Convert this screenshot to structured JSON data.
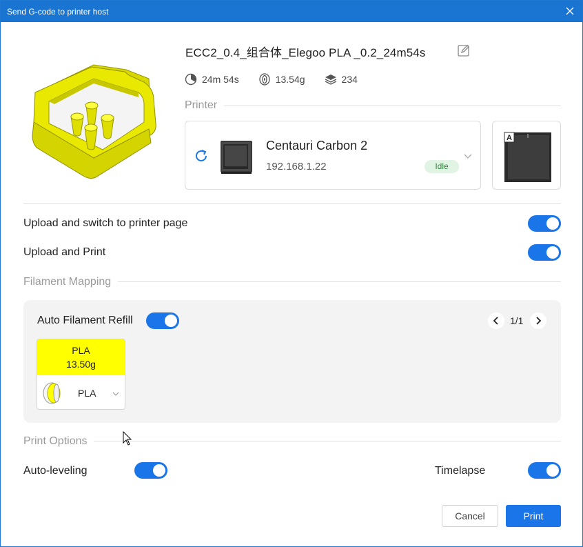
{
  "window": {
    "title": "Send G-code to printer host"
  },
  "file": {
    "name": "ECC2_0.4_组合体_Elegoo PLA _0.2_24m54s",
    "time": "24m 54s",
    "weight": "13.54g",
    "layers": "234"
  },
  "printer_section": {
    "label": "Printer",
    "name": "Centauri Carbon 2",
    "ip": "192.168.1.22",
    "status": "Idle",
    "plate_badge": "A"
  },
  "options": {
    "upload_switch_label": "Upload and switch to printer page",
    "upload_switch_on": true,
    "upload_print_label": "Upload and Print",
    "upload_print_on": true
  },
  "filament_mapping": {
    "label": "Filament Mapping",
    "auto_refill_label": "Auto Filament Refill",
    "auto_refill_on": true,
    "page": "1/1",
    "slots": [
      {
        "type": "PLA",
        "weight": "13.50g",
        "color": "#ffff00",
        "mapped": "PLA"
      }
    ]
  },
  "print_options": {
    "label": "Print Options",
    "auto_leveling_label": "Auto-leveling",
    "auto_leveling_on": true,
    "timelapse_label": "Timelapse",
    "timelapse_on": true
  },
  "buttons": {
    "cancel": "Cancel",
    "print": "Print"
  },
  "colors": {
    "accent": "#1a76e8",
    "titlebar": "#1a75d2",
    "model": "#e6e600",
    "idle_bg": "#e1f3e3",
    "idle_text": "#2e8b3d"
  },
  "icons": [
    "close-icon",
    "edit-icon",
    "clock-icon",
    "spool-icon",
    "layers-icon",
    "refresh-icon",
    "chevron-down-icon",
    "chevron-left-icon",
    "chevron-right-icon"
  ]
}
